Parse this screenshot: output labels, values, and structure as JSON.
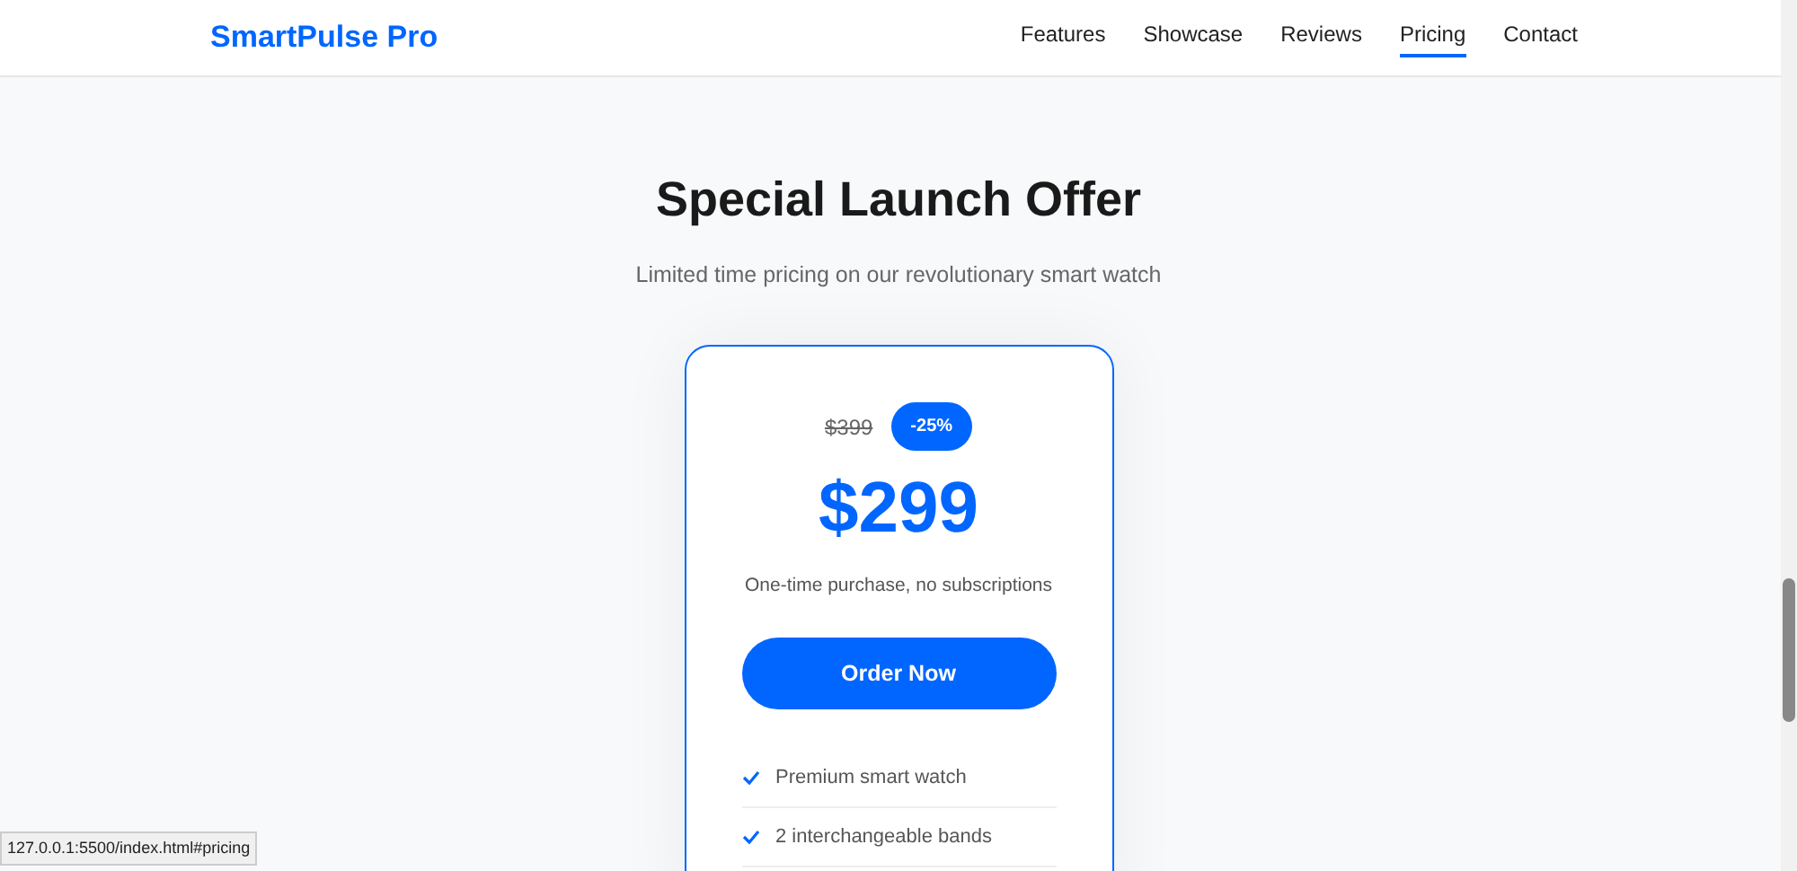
{
  "header": {
    "logo": "SmartPulse Pro",
    "nav": [
      {
        "label": "Features",
        "selected": false
      },
      {
        "label": "Showcase",
        "selected": false
      },
      {
        "label": "Reviews",
        "selected": false
      },
      {
        "label": "Pricing",
        "selected": true
      },
      {
        "label": "Contact",
        "selected": false
      }
    ]
  },
  "section": {
    "title": "Special Launch Offer",
    "subtitle": "Limited time pricing on our revolutionary smart watch"
  },
  "card": {
    "old_price": "$399",
    "discount": "-25%",
    "price": "$299",
    "note": "One-time purchase, no subscriptions",
    "button": "Order Now",
    "features": [
      "Premium smart watch",
      "2 interchangeable bands"
    ]
  },
  "status_bar": {
    "url": "127.0.0.1:5500/index.html#pricing"
  }
}
